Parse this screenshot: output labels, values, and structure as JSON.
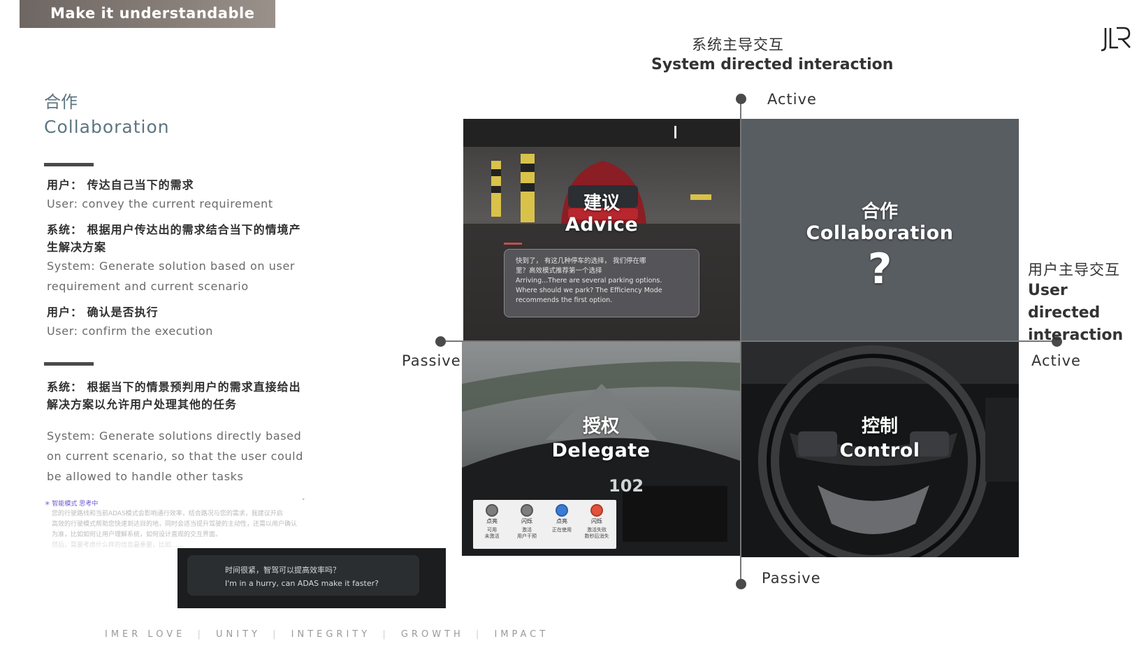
{
  "banner": {
    "title": "Make it understandable"
  },
  "left": {
    "heading_zh": "合作",
    "heading_en": "Collaboration",
    "block1": {
      "user1_zh": "用户： 传达自己当下的需求",
      "user1_en": "User: convey the current requirement",
      "system_zh_line1": "系统： 根据用户传达出的需求结合当下的情境产",
      "system_zh_line2": "生解决方案",
      "system_en_line1": "System: Generate solution based on user",
      "system_en_line2": "requirement and current scenario",
      "user2_zh": "用户： 确认是否执行",
      "user2_en": "User: confirm the execution"
    },
    "block2": {
      "system_zh_line1": "系统： 根据当下的情景预判用户的需求直接给出",
      "system_zh_line2": "解决方案以允许用户处理其他的任务",
      "system_en_line1": "System: Generate solutions directly based",
      "system_en_line2": "on current scenario, so that the user could",
      "system_en_line3": "be allowed to handle other tasks"
    },
    "mini_chat": {
      "header": "✳ 智能模式 思考中",
      "caret": "˅",
      "body_line1": "您的行驶路线和当前ADAS模式会影响通行效率，结合路况与您的需求，我建议开启",
      "body_line2": "高效的行驶模式帮助您快速到达目的地，同时会适当提升驾驶的主动性，还需以用户确认",
      "body_line3": "为准，比如如何让用户理解系统，如何设计直观的交互界面。",
      "body_line4": "然后，需要考虑什么样的信息最重要，比如……"
    },
    "hurry": {
      "zh": "时间很紧，智驾可以提高效率吗？",
      "en": "I'm in a hurry, can ADAS make it faster?"
    }
  },
  "values": {
    "items": [
      "IMER LOVE",
      "UNITY",
      "INTEGRITY",
      "GROWTH",
      "IMPACT"
    ],
    "separator": "|"
  },
  "diagram": {
    "top_zh": "系统主导交互",
    "top_en": "System directed interaction",
    "right_zh": "用户主导交互",
    "right_en": "User directed interaction",
    "top_axis": "Active",
    "bottom_axis": "Passive",
    "left_axis": "Passive",
    "right_axis": "Active",
    "advice": {
      "zh": "建议",
      "en": "Advice",
      "card_line1": "快到了， 有这几种停车的选择， 我们停在哪",
      "card_line2": "里？高效模式推荐第一个选择",
      "card_line3": "Arriving...There are several parking options.",
      "card_line4": "Where should we park? The Efficiency Mode",
      "card_line5": "recommends the first option."
    },
    "collaboration": {
      "zh": "合作",
      "en": "Collaboration",
      "mark": "?"
    },
    "delegate": {
      "zh": "授权",
      "en": "Delegate",
      "speed": "102",
      "legend": [
        {
          "title": "点亮",
          "desc1": "可用",
          "desc2": "未激活",
          "color": "#7d7d7d"
        },
        {
          "title": "闪烁",
          "desc1": "激活",
          "desc2": "用户干预",
          "color": "#7d7d7d"
        },
        {
          "title": "点亮",
          "desc1": "正在使用",
          "desc2": "",
          "color": "#3a7bd5"
        },
        {
          "title": "闪烁",
          "desc1": "激活失败",
          "desc2": "数秒后消失",
          "color": "#e0523b"
        }
      ]
    },
    "control": {
      "zh": "控制",
      "en": "Control"
    }
  },
  "colors": {
    "accent_teal": "#5d7680",
    "collab_panel": "#585d62"
  }
}
